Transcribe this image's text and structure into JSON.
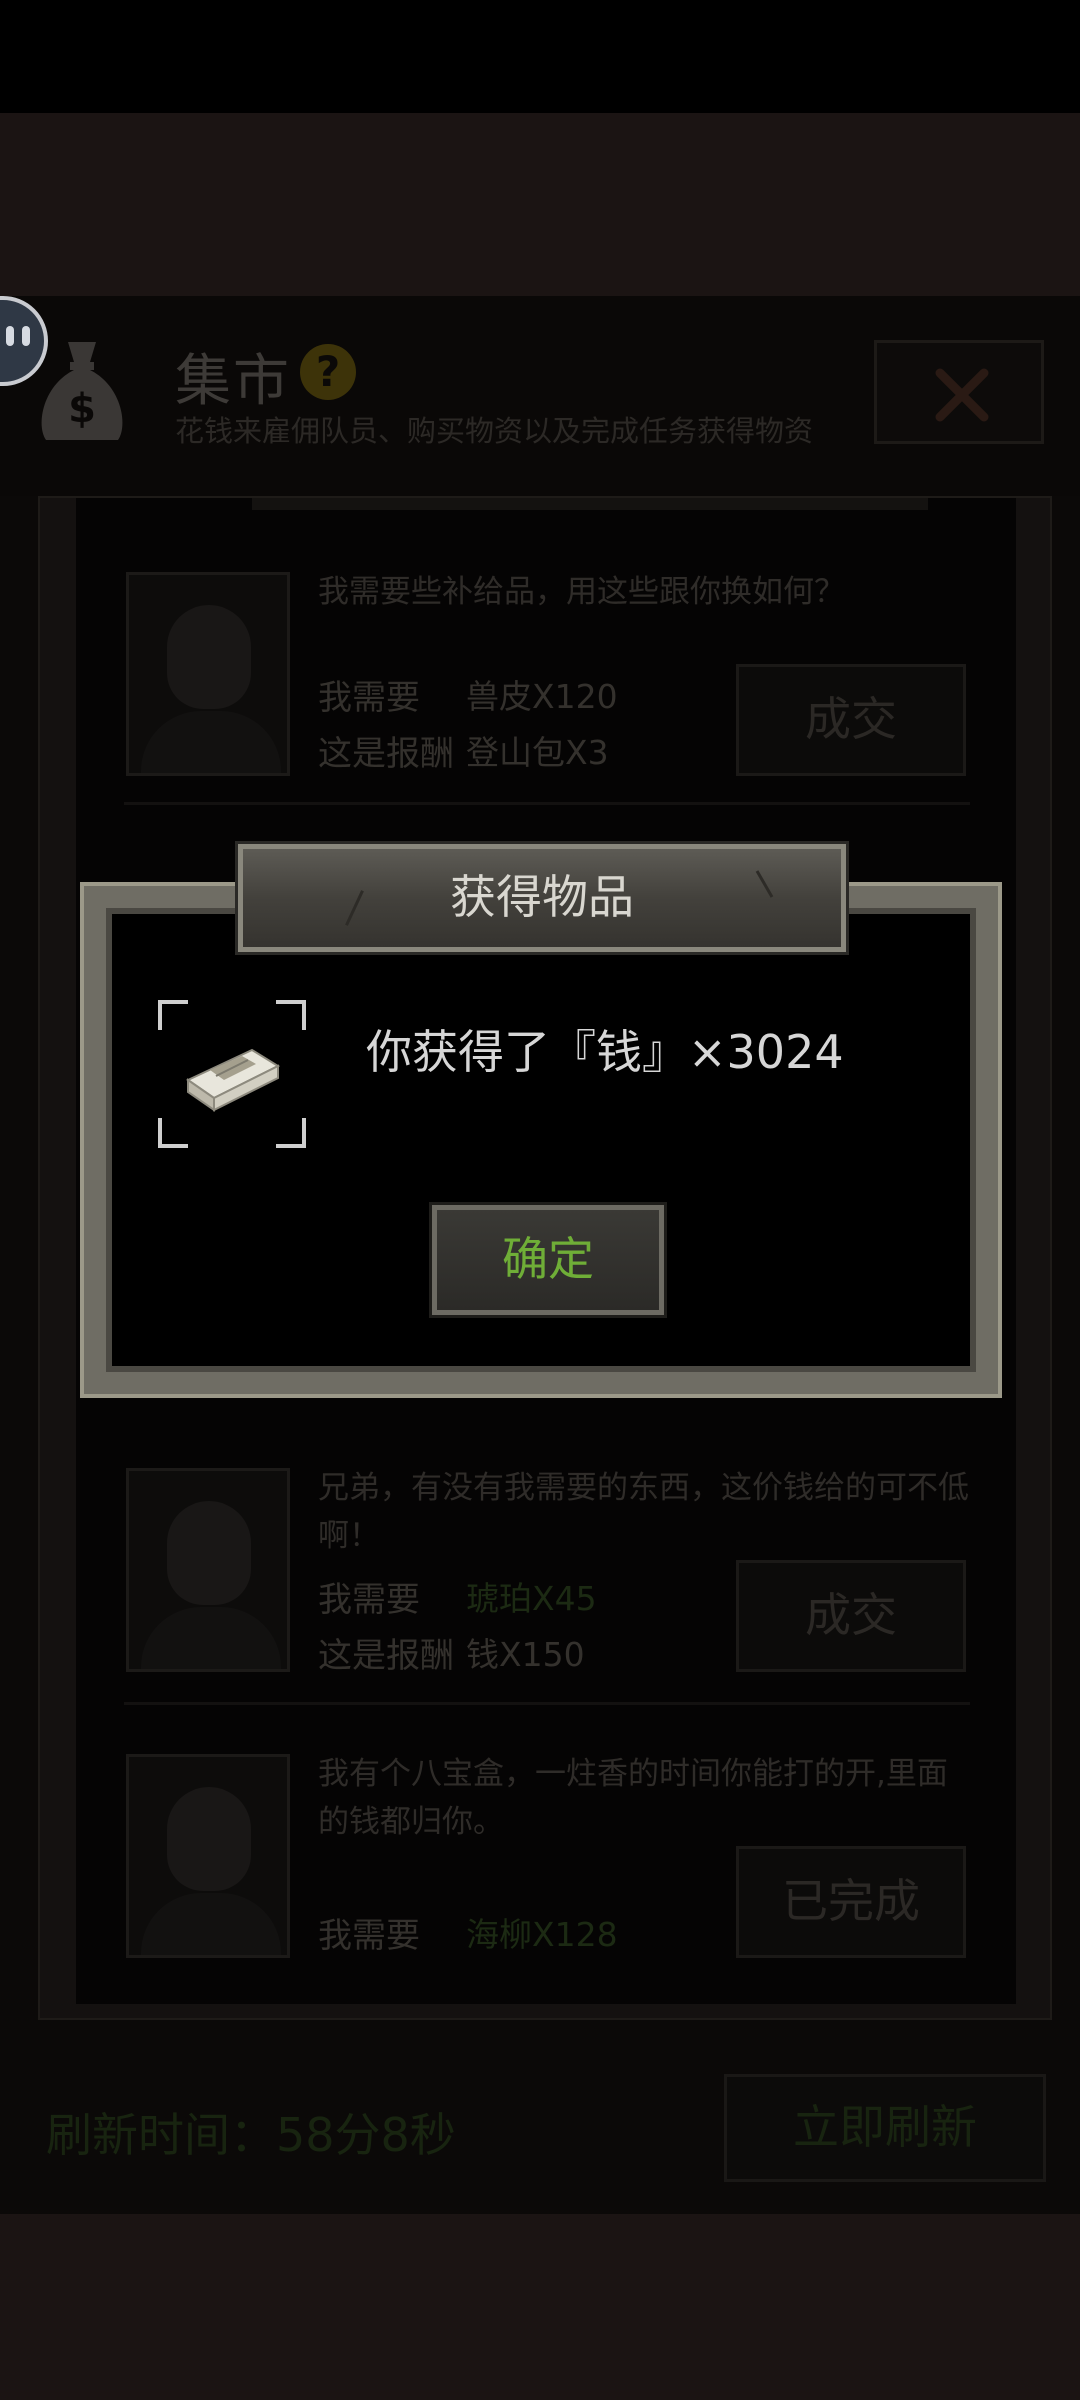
{
  "header": {
    "title": "集市",
    "subtitle": "花钱来雇佣队员、购买物资以及完成任务获得物资"
  },
  "trades": [
    {
      "message": "我需要些补给品，用这些跟你换如何？",
      "need_label": "我需要",
      "need_item": "兽皮X120",
      "reward_label": "这是报酬",
      "reward_item": "登山包X3",
      "button": "成交"
    },
    {
      "message": "兄弟，有没有我需要的东西，这价钱给的可不低啊！",
      "need_label": "我需要",
      "need_item": "琥珀X45",
      "reward_label": "这是报酬",
      "reward_item": "钱X150",
      "button": "成交"
    },
    {
      "message": "我有个八宝盒，一炷香的时间你能打的开,里面的钱都归你。",
      "need_label": "我需要",
      "need_item": "海柳X128",
      "button": "已完成"
    }
  ],
  "footer": {
    "refresh_time": "刷新时间：58分8秒",
    "refresh_button": "立即刷新"
  },
  "modal": {
    "title": "获得物品",
    "message": "你获得了『钱』×3024",
    "confirm": "确定",
    "item_icon": "money-stack-icon"
  },
  "colors": {
    "confirm_text": "#6fae37",
    "modal_frame": "#6f6d64",
    "green_item": "#1c2a13"
  }
}
